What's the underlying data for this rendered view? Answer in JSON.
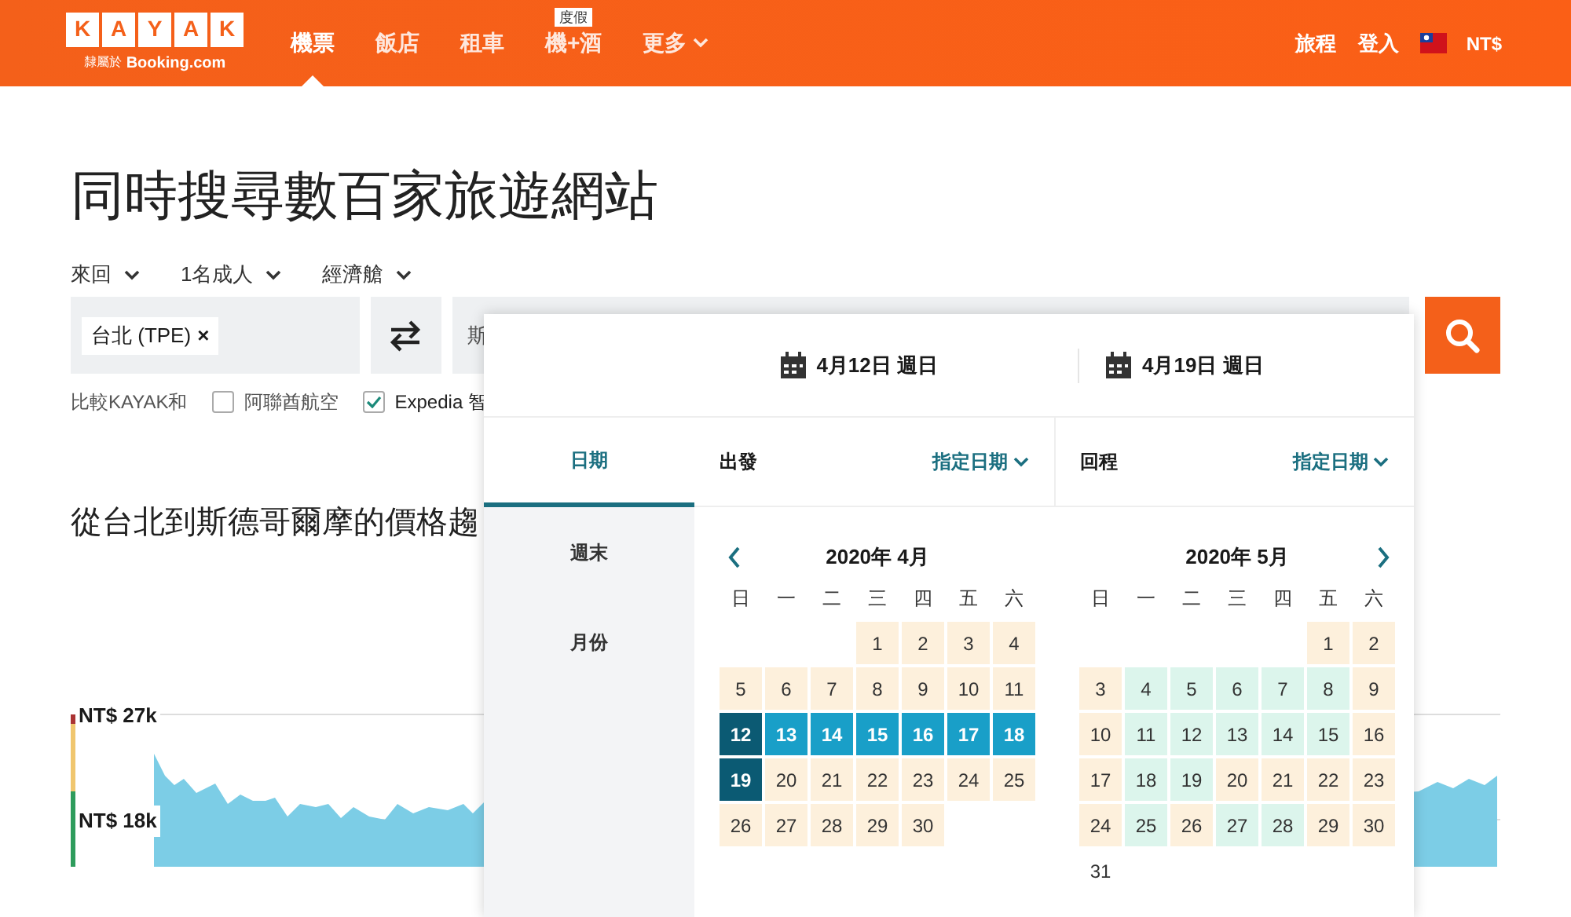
{
  "header": {
    "logo_letters": [
      "K",
      "A",
      "Y",
      "A",
      "K"
    ],
    "logo_tagline": "隸屬於",
    "logo_brand": "Booking.com",
    "nav": [
      {
        "label": "機票",
        "selected": true
      },
      {
        "label": "飯店",
        "selected": false
      },
      {
        "label": "租車",
        "selected": false
      },
      {
        "label": "機+酒",
        "selected": false,
        "badge": "度假"
      },
      {
        "label": "更多",
        "selected": false,
        "dropdown": true
      }
    ],
    "account_links": [
      "旅程",
      "登入"
    ],
    "currency": "NT$"
  },
  "title": "同時搜尋數百家旅遊網站",
  "options": [
    "來回",
    "1名成人",
    "經濟艙"
  ],
  "search": {
    "origin": "台北 (TPE)",
    "origin_remove": "×",
    "destination": "斯"
  },
  "compare": {
    "label": "比較KAYAK和",
    "items": [
      {
        "label": "阿聯酋航空",
        "checked": false
      },
      {
        "label": "Expedia 智",
        "checked": true
      }
    ]
  },
  "trend_title": "從台北到斯德哥爾摩的價格趨",
  "trend_ticks": [
    "NT$ 27k",
    "NT$ 18k"
  ],
  "date_picker": {
    "depart_date": "4月12日 週日",
    "return_date": "4月19日 週日",
    "modes": [
      {
        "label": "日期",
        "selected": true
      },
      {
        "label": "週末",
        "selected": false
      },
      {
        "label": "月份",
        "selected": false
      }
    ],
    "legs": [
      {
        "label": "出發",
        "flex": "指定日期"
      },
      {
        "label": "回程",
        "flex": "指定日期"
      }
    ],
    "months": [
      {
        "title": "2020年 4月",
        "kind": "prev",
        "weekdays": [
          "日",
          "一",
          "二",
          "三",
          "四",
          "五",
          "六"
        ],
        "days": [
          {
            "kind": "empty"
          },
          {
            "kind": "empty"
          },
          {
            "kind": "empty"
          },
          {
            "day": "1",
            "kind": "mid"
          },
          {
            "day": "2",
            "kind": "mid"
          },
          {
            "day": "3",
            "kind": "mid"
          },
          {
            "day": "4",
            "kind": "mid"
          },
          {
            "day": "5",
            "kind": "mid"
          },
          {
            "day": "6",
            "kind": "mid"
          },
          {
            "day": "7",
            "kind": "mid"
          },
          {
            "day": "8",
            "kind": "mid"
          },
          {
            "day": "9",
            "kind": "mid"
          },
          {
            "day": "10",
            "kind": "mid"
          },
          {
            "day": "11",
            "kind": "mid"
          },
          {
            "day": "12",
            "kind": "end"
          },
          {
            "day": "13",
            "kind": "range"
          },
          {
            "day": "14",
            "kind": "range"
          },
          {
            "day": "15",
            "kind": "range"
          },
          {
            "day": "16",
            "kind": "range"
          },
          {
            "day": "17",
            "kind": "range"
          },
          {
            "day": "18",
            "kind": "range"
          },
          {
            "day": "19",
            "kind": "end"
          },
          {
            "day": "20",
            "kind": "mid"
          },
          {
            "day": "21",
            "kind": "mid"
          },
          {
            "day": "22",
            "kind": "mid"
          },
          {
            "day": "23",
            "kind": "mid"
          },
          {
            "day": "24",
            "kind": "mid"
          },
          {
            "day": "25",
            "kind": "mid"
          },
          {
            "day": "26",
            "kind": "mid"
          },
          {
            "day": "27",
            "kind": "mid"
          },
          {
            "day": "28",
            "kind": "mid"
          },
          {
            "day": "29",
            "kind": "mid"
          },
          {
            "day": "30",
            "kind": "mid"
          }
        ]
      },
      {
        "title": "2020年 5月",
        "kind": "next",
        "weekdays": [
          "日",
          "一",
          "二",
          "三",
          "四",
          "五",
          "六"
        ],
        "days": [
          {
            "kind": "empty"
          },
          {
            "kind": "empty"
          },
          {
            "kind": "empty"
          },
          {
            "kind": "empty"
          },
          {
            "kind": "empty"
          },
          {
            "day": "1",
            "kind": "mid"
          },
          {
            "day": "2",
            "kind": "mid"
          },
          {
            "day": "3",
            "kind": "mid"
          },
          {
            "day": "4",
            "kind": "low"
          },
          {
            "day": "5",
            "kind": "low"
          },
          {
            "day": "6",
            "kind": "low"
          },
          {
            "day": "7",
            "kind": "low"
          },
          {
            "day": "8",
            "kind": "low"
          },
          {
            "day": "9",
            "kind": "mid"
          },
          {
            "day": "10",
            "kind": "mid"
          },
          {
            "day": "11",
            "kind": "low"
          },
          {
            "day": "12",
            "kind": "low"
          },
          {
            "day": "13",
            "kind": "low"
          },
          {
            "day": "14",
            "kind": "low"
          },
          {
            "day": "15",
            "kind": "low"
          },
          {
            "day": "16",
            "kind": "mid"
          },
          {
            "day": "17",
            "kind": "mid"
          },
          {
            "day": "18",
            "kind": "low"
          },
          {
            "day": "19",
            "kind": "low"
          },
          {
            "day": "20",
            "kind": "mid"
          },
          {
            "day": "21",
            "kind": "mid"
          },
          {
            "day": "22",
            "kind": "mid"
          },
          {
            "day": "23",
            "kind": "mid"
          },
          {
            "day": "24",
            "kind": "mid"
          },
          {
            "day": "25",
            "kind": "low"
          },
          {
            "day": "26",
            "kind": "mid"
          },
          {
            "day": "27",
            "kind": "low"
          },
          {
            "day": "28",
            "kind": "low"
          },
          {
            "day": "29",
            "kind": "mid"
          },
          {
            "day": "30",
            "kind": "mid"
          },
          {
            "day": "31",
            "kind": "plain"
          }
        ]
      }
    ]
  }
}
